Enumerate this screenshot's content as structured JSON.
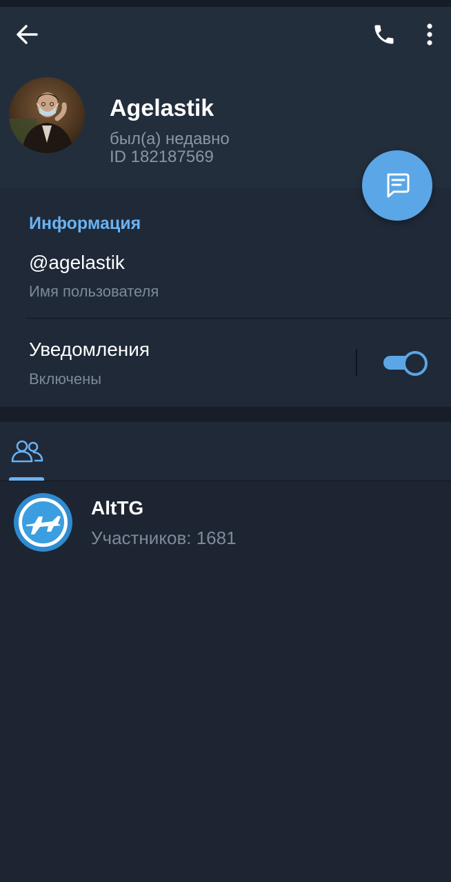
{
  "header": {
    "name": "Agelastik",
    "last_seen": "был(а) недавно",
    "user_id": "ID 182187569",
    "icons": {
      "back": "arrow-back-icon",
      "call": "phone-icon",
      "more": "more-vertical-icon",
      "message": "message-icon"
    }
  },
  "info": {
    "title": "Информация",
    "username": "@agelastik",
    "username_caption": "Имя пользователя",
    "notifications_label": "Уведомления",
    "notifications_status": "Включены",
    "notifications_enabled": true
  },
  "tabs": {
    "groups_icon": "groups-icon"
  },
  "groups": [
    {
      "name": "AltTG",
      "members": "Участников: 1681"
    }
  ],
  "colors": {
    "accent": "#6ab2f2",
    "fab": "#5ba6e6",
    "header_bg": "#232e3d",
    "page_bg": "#1d2532",
    "secondary_text": "#7e8a9a"
  }
}
